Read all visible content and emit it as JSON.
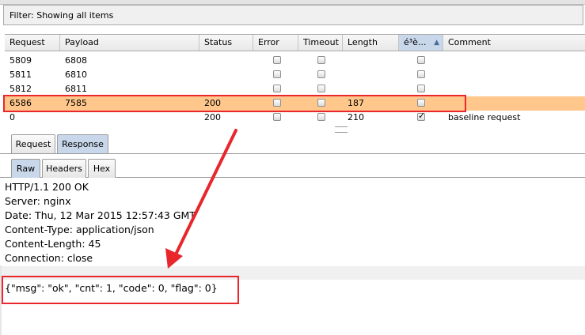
{
  "filter": {
    "text": "Filter: Showing all items"
  },
  "table": {
    "columns": [
      "Request",
      "Payload",
      "Status",
      "Error",
      "Timeout",
      "Length",
      "é³è...",
      "Comment"
    ],
    "rows": [
      {
        "request": "5809",
        "payload": "6808",
        "status": "",
        "error": false,
        "timeout": false,
        "length": "",
        "flag": false,
        "comment": ""
      },
      {
        "request": "5811",
        "payload": "6810",
        "status": "",
        "error": false,
        "timeout": false,
        "length": "",
        "flag": false,
        "comment": ""
      },
      {
        "request": "5812",
        "payload": "6811",
        "status": "",
        "error": false,
        "timeout": false,
        "length": "",
        "flag": false,
        "comment": ""
      },
      {
        "request": "6586",
        "payload": "7585",
        "status": "200",
        "error": false,
        "timeout": false,
        "length": "187",
        "flag": false,
        "comment": "",
        "selected": true
      },
      {
        "request": "0",
        "payload": "",
        "status": "200",
        "error": false,
        "timeout": false,
        "length": "210",
        "flag": true,
        "comment": "baseline request"
      }
    ]
  },
  "tabs_top": [
    "Request",
    "Response"
  ],
  "tabs_top_active": "Response",
  "tabs_sub": [
    "Raw",
    "Headers",
    "Hex"
  ],
  "tabs_sub_active": "Raw",
  "response": {
    "headers": [
      "HTTP/1.1 200 OK",
      "Server: nginx",
      "Date: Thu, 12 Mar 2015 12:57:43 GMT",
      "Content-Type: application/json",
      "Content-Length: 45",
      "Connection: close"
    ],
    "body": "{\"msg\": \"ok\", \"cnt\": 1, \"code\": 0, \"flag\": 0}"
  },
  "colors": {
    "highlight": "#ffc78b",
    "annotation": "#e8262c",
    "active_tab": "#c8d7ea"
  }
}
